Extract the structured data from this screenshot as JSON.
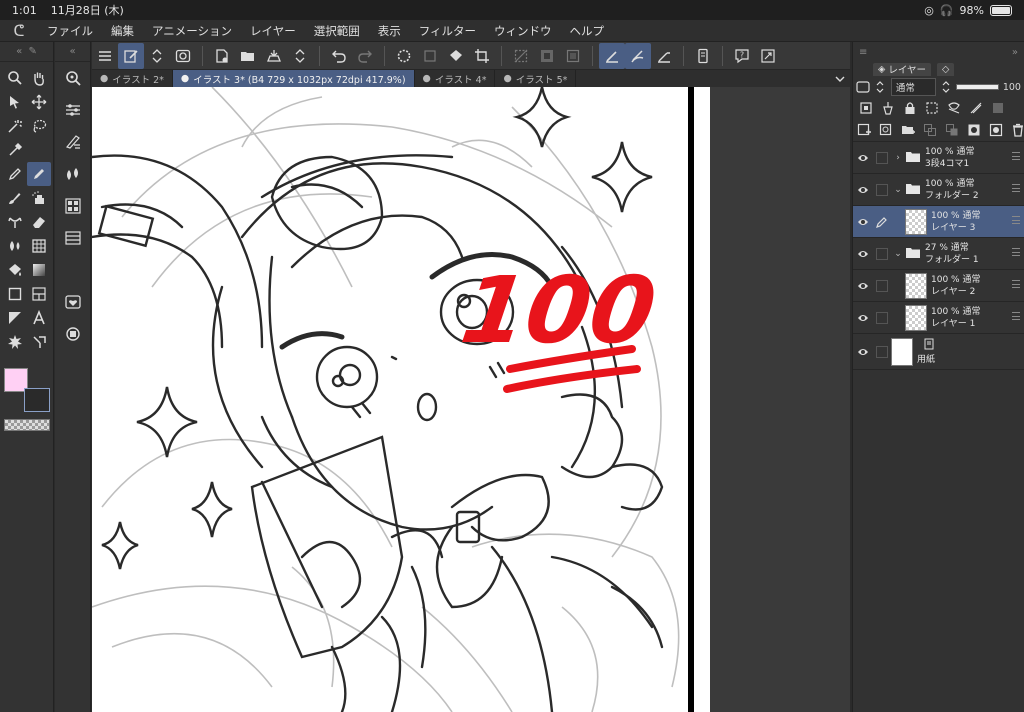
{
  "status": {
    "time": "1:01",
    "date": "11月28日 (木)",
    "battery": "98%",
    "battery_level": 0.98
  },
  "menu": {
    "items": [
      "ファイル",
      "編集",
      "アニメーション",
      "レイヤー",
      "選択範囲",
      "表示",
      "フィルター",
      "ウィンドウ",
      "ヘルプ"
    ]
  },
  "tabs": [
    {
      "label": "イラスト 2*",
      "active": false
    },
    {
      "label": "イラスト 3* (B4 729 x 1032px 72dpi 417.9%)",
      "active": true
    },
    {
      "label": "イラスト 4*",
      "active": false
    },
    {
      "label": "イラスト 5*",
      "active": false
    }
  ],
  "layer_panel": {
    "tab_label": "レイヤー",
    "blend_mode": "通常",
    "opacity": "100",
    "layers": [
      {
        "line1": "100 % 通常",
        "line2": "3段4コマ1",
        "type": "folder",
        "collapsed": true,
        "indent": 0,
        "selected": false,
        "edit": false
      },
      {
        "line1": "100 % 通常",
        "line2": "フォルダー 2",
        "type": "folder",
        "collapsed": false,
        "indent": 0,
        "selected": false,
        "edit": false
      },
      {
        "line1": "100 % 通常",
        "line2": "レイヤー 3",
        "type": "raster",
        "indent": 1,
        "selected": true,
        "edit": true
      },
      {
        "line1": "27 % 通常",
        "line2": "フォルダー 1",
        "type": "folder",
        "collapsed": false,
        "indent": 0,
        "selected": false,
        "edit": false
      },
      {
        "line1": "100 % 通常",
        "line2": "レイヤー 2",
        "type": "raster",
        "indent": 1,
        "selected": false,
        "edit": false
      },
      {
        "line1": "100 % 通常",
        "line2": "レイヤー 1",
        "type": "raster",
        "indent": 1,
        "selected": false,
        "edit": false
      },
      {
        "line1": "",
        "line2": "用紙",
        "type": "paper",
        "indent": 0,
        "selected": false,
        "edit": false
      }
    ]
  },
  "canvas": {
    "stamp_text": "100",
    "stamp_color": "#e8141b"
  },
  "colors": {
    "main": "#ffd0f4",
    "accent": "#4a5e84"
  }
}
